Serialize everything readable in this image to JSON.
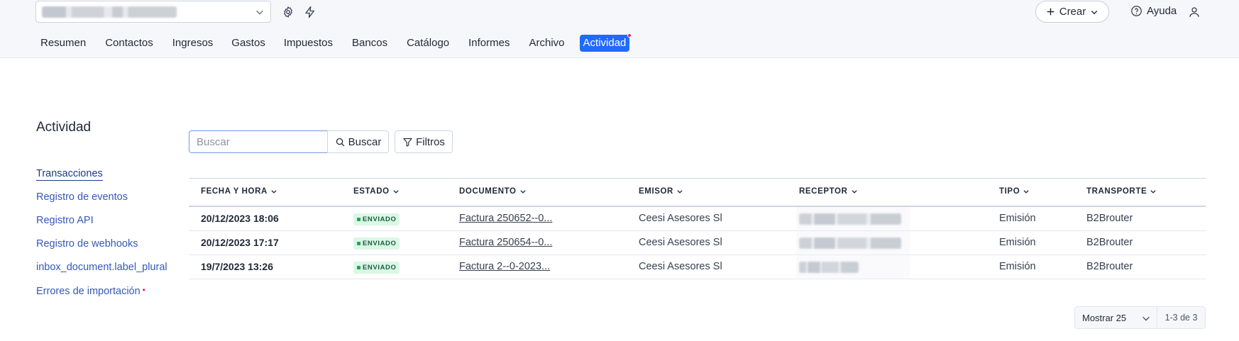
{
  "header": {
    "company_select_value": "",
    "create_label": "Crear",
    "help_label": "Ayuda",
    "icons": [
      "settings-icon",
      "lightning-icon",
      "plus-icon",
      "chevron-down-icon",
      "help-circle-icon",
      "user-icon"
    ]
  },
  "nav": {
    "items": [
      {
        "label": "Resumen"
      },
      {
        "label": "Contactos"
      },
      {
        "label": "Ingresos"
      },
      {
        "label": "Gastos"
      },
      {
        "label": "Impuestos"
      },
      {
        "label": "Bancos"
      },
      {
        "label": "Catálogo"
      },
      {
        "label": "Informes"
      },
      {
        "label": "Archivo"
      },
      {
        "label": "Actividad",
        "active": true,
        "notification": true
      }
    ]
  },
  "page": {
    "title": "Actividad"
  },
  "sidebar": {
    "items": [
      {
        "label": "Transacciones",
        "active": true
      },
      {
        "label": "Registro de eventos"
      },
      {
        "label": "Registro API"
      },
      {
        "label": "Registro de webhooks"
      },
      {
        "label": "inbox_document.label_plural"
      },
      {
        "label": "Errores de importación",
        "required_dot": "•"
      }
    ]
  },
  "search": {
    "placeholder": "Buscar",
    "value": "",
    "button_label": "Buscar",
    "filters_label": "Filtros"
  },
  "table": {
    "columns": [
      "FECHA Y HORA",
      "ESTADO",
      "DOCUMENTO",
      "EMISOR",
      "RECEPTOR",
      "TIPO",
      "TRANSPORTE"
    ],
    "rows": [
      {
        "date": "20/12/2023 18:06",
        "status": "ENVIADO",
        "document": "Factura 250652--0...",
        "issuer": "Ceesi Asesores Sl",
        "receiver": "",
        "type": "Emisión",
        "transport": "B2Brouter"
      },
      {
        "date": "20/12/2023 17:17",
        "status": "ENVIADO",
        "document": "Factura 250654--0...",
        "issuer": "Ceesi Asesores Sl",
        "receiver": "",
        "type": "Emisión",
        "transport": "B2Brouter"
      },
      {
        "date": "19/7/2023 13:26",
        "status": "ENVIADO",
        "document": "Factura 2--0-2023...",
        "issuer": "Ceesi Asesores Sl",
        "receiver": "",
        "type": "Emisión",
        "transport": "B2Brouter"
      }
    ]
  },
  "pagination": {
    "page_size_label": "Mostrar 25",
    "range_label": "1-3 de 3"
  },
  "colors": {
    "accent": "#1f6bff",
    "link": "#3559b8",
    "status_sent_bg": "#dcf7e6",
    "status_sent_dot": "#1ea75a",
    "notification": "#e0245e"
  }
}
